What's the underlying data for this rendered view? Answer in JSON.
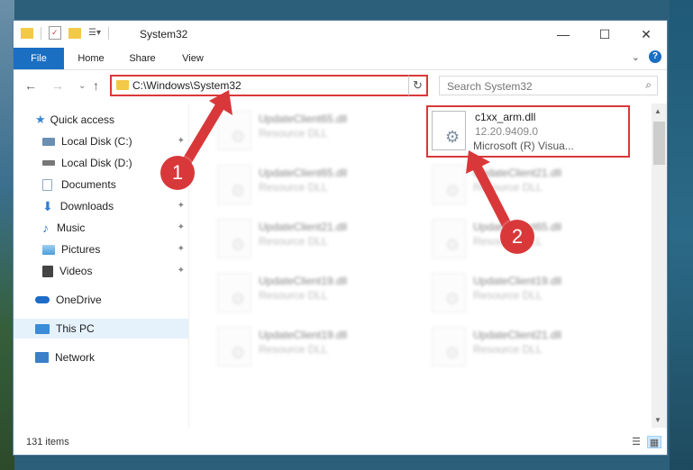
{
  "window": {
    "title": "System32",
    "minimize_icon": "—",
    "maximize_icon": "☐",
    "close_icon": "✕"
  },
  "ribbon": {
    "tabs": [
      "File",
      "Home",
      "Share",
      "View"
    ],
    "expand_icon": "⌄",
    "help_icon": "?"
  },
  "nav": {
    "back_icon": "←",
    "forward_icon": "→",
    "up_icon": "↑",
    "address": "C:\\Windows\\System32",
    "dropdown_icon": "⌄",
    "refresh_icon": "↻",
    "search_placeholder": "Search System32",
    "search_icon": "⌕"
  },
  "sidebar": {
    "items": [
      {
        "label": "Quick access",
        "icon": "star-icon",
        "color": "#3a86d6"
      },
      {
        "label": "Local Disk (C:)",
        "icon": "drive-icon",
        "color": "#6a8fb0",
        "pinned": true
      },
      {
        "label": "Local Disk (D:)",
        "icon": "drive-icon",
        "color": "#6a8fb0"
      },
      {
        "label": "Documents",
        "icon": "documents-icon",
        "color": "#8fa8c0"
      },
      {
        "label": "Downloads",
        "icon": "downloads-icon",
        "color": "#2f7fd3",
        "pinned": true
      },
      {
        "label": "Music",
        "icon": "music-icon",
        "color": "#3c7fd0",
        "pinned": true
      },
      {
        "label": "Pictures",
        "icon": "pictures-icon",
        "color": "#4d9dd8",
        "pinned": true
      },
      {
        "label": "Videos",
        "icon": "videos-icon",
        "color": "#444",
        "pinned": true
      },
      {
        "label": "OneDrive",
        "icon": "onedrive-icon",
        "color": "#1e6cc8"
      },
      {
        "label": "This PC",
        "icon": "this-pc-icon",
        "color": "#3a8bd8"
      },
      {
        "label": "Network",
        "icon": "network-icon",
        "color": "#3a7fc8"
      }
    ],
    "pin_icon": "📌"
  },
  "files": {
    "left_column": [
      {
        "name": "UpdateClient65.dll",
        "type": "Resource DLL"
      },
      {
        "name": "UpdateClient65.dll",
        "type": "Resource DLL"
      },
      {
        "name": "UpdateClient21.dll",
        "type": "Resource DLL"
      },
      {
        "name": "UpdateClient19.dll",
        "type": "Resource DLL"
      },
      {
        "name": "UpdateClient19.dll",
        "type": "Resource DLL"
      }
    ],
    "right_column": [
      {
        "name": "c1xx_arm.dll",
        "version": "12.20.9409.0",
        "company": "Microsoft (R) Visua..."
      },
      {
        "name": "UpdateClient21.dll",
        "type": "Resource DLL"
      },
      {
        "name": "UpdateClient65.dll",
        "type": "Resource DLL"
      },
      {
        "name": "UpdateClient19.dll",
        "type": "Resource DLL"
      },
      {
        "name": "UpdateClient21.dll",
        "type": "Resource DLL"
      }
    ]
  },
  "status": {
    "item_count": "131 items"
  },
  "callouts": [
    "1",
    "2"
  ],
  "colors": {
    "accent": "#1a6fc3",
    "highlight_red": "#d9383a",
    "folder_yellow": "#f3c948"
  }
}
